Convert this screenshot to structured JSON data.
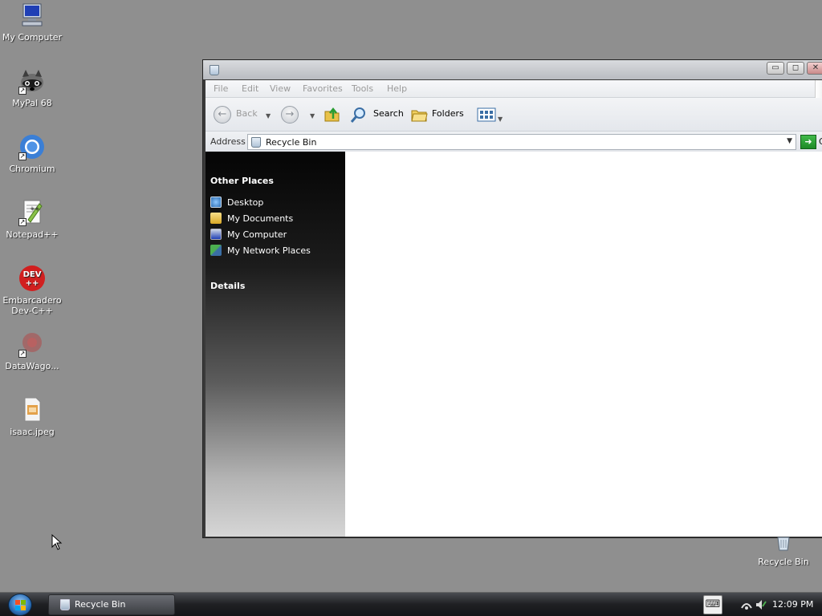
{
  "desktop": {
    "icons": [
      {
        "label": "My Computer",
        "icon": "computer-icon",
        "shortcut": false
      },
      {
        "label": "MyPal 68",
        "icon": "raccoon-icon",
        "shortcut": true
      },
      {
        "label": "Chromium",
        "icon": "chromium-icon",
        "shortcut": true
      },
      {
        "label": "Notepad++",
        "icon": "notepad-plus-plus-icon",
        "shortcut": true
      },
      {
        "label": "Embarcadero Dev-C++",
        "icon": "dev-cpp-icon",
        "shortcut": true,
        "glyph_text": "DEV ++"
      },
      {
        "label": "DataWago...",
        "icon": "datawagon-icon",
        "shortcut": true
      },
      {
        "label": "isaac.jpeg",
        "icon": "image-file-icon",
        "shortcut": false
      }
    ],
    "recycle_bin_label": "Recycle Bin"
  },
  "window": {
    "title": "",
    "controls": {
      "minimize": "▭",
      "maximize": "◻",
      "close": "✕"
    },
    "menu": [
      "File",
      "Edit",
      "View",
      "Favorites",
      "Tools",
      "Help"
    ],
    "toolbar": {
      "back_label": "Back",
      "search_label": "Search",
      "folders_label": "Folders"
    },
    "address": {
      "label": "Address",
      "value": "Recycle Bin",
      "go_label": "Go"
    },
    "sidebar": {
      "other_places_heading": "Other Places",
      "links": [
        {
          "label": "Desktop",
          "icon": "desktop-icon"
        },
        {
          "label": "My Documents",
          "icon": "documents-folder-icon"
        },
        {
          "label": "My Computer",
          "icon": "computer-icon"
        },
        {
          "label": "My Network Places",
          "icon": "network-places-icon"
        }
      ],
      "details_heading": "Details"
    }
  },
  "taskbar": {
    "task_label": "Recycle Bin",
    "clock": "12:09 PM"
  },
  "colors": {
    "desktop_bg": "#8f8f8f",
    "go_green": "#2a9d32",
    "taskbar": "#1f2023"
  }
}
